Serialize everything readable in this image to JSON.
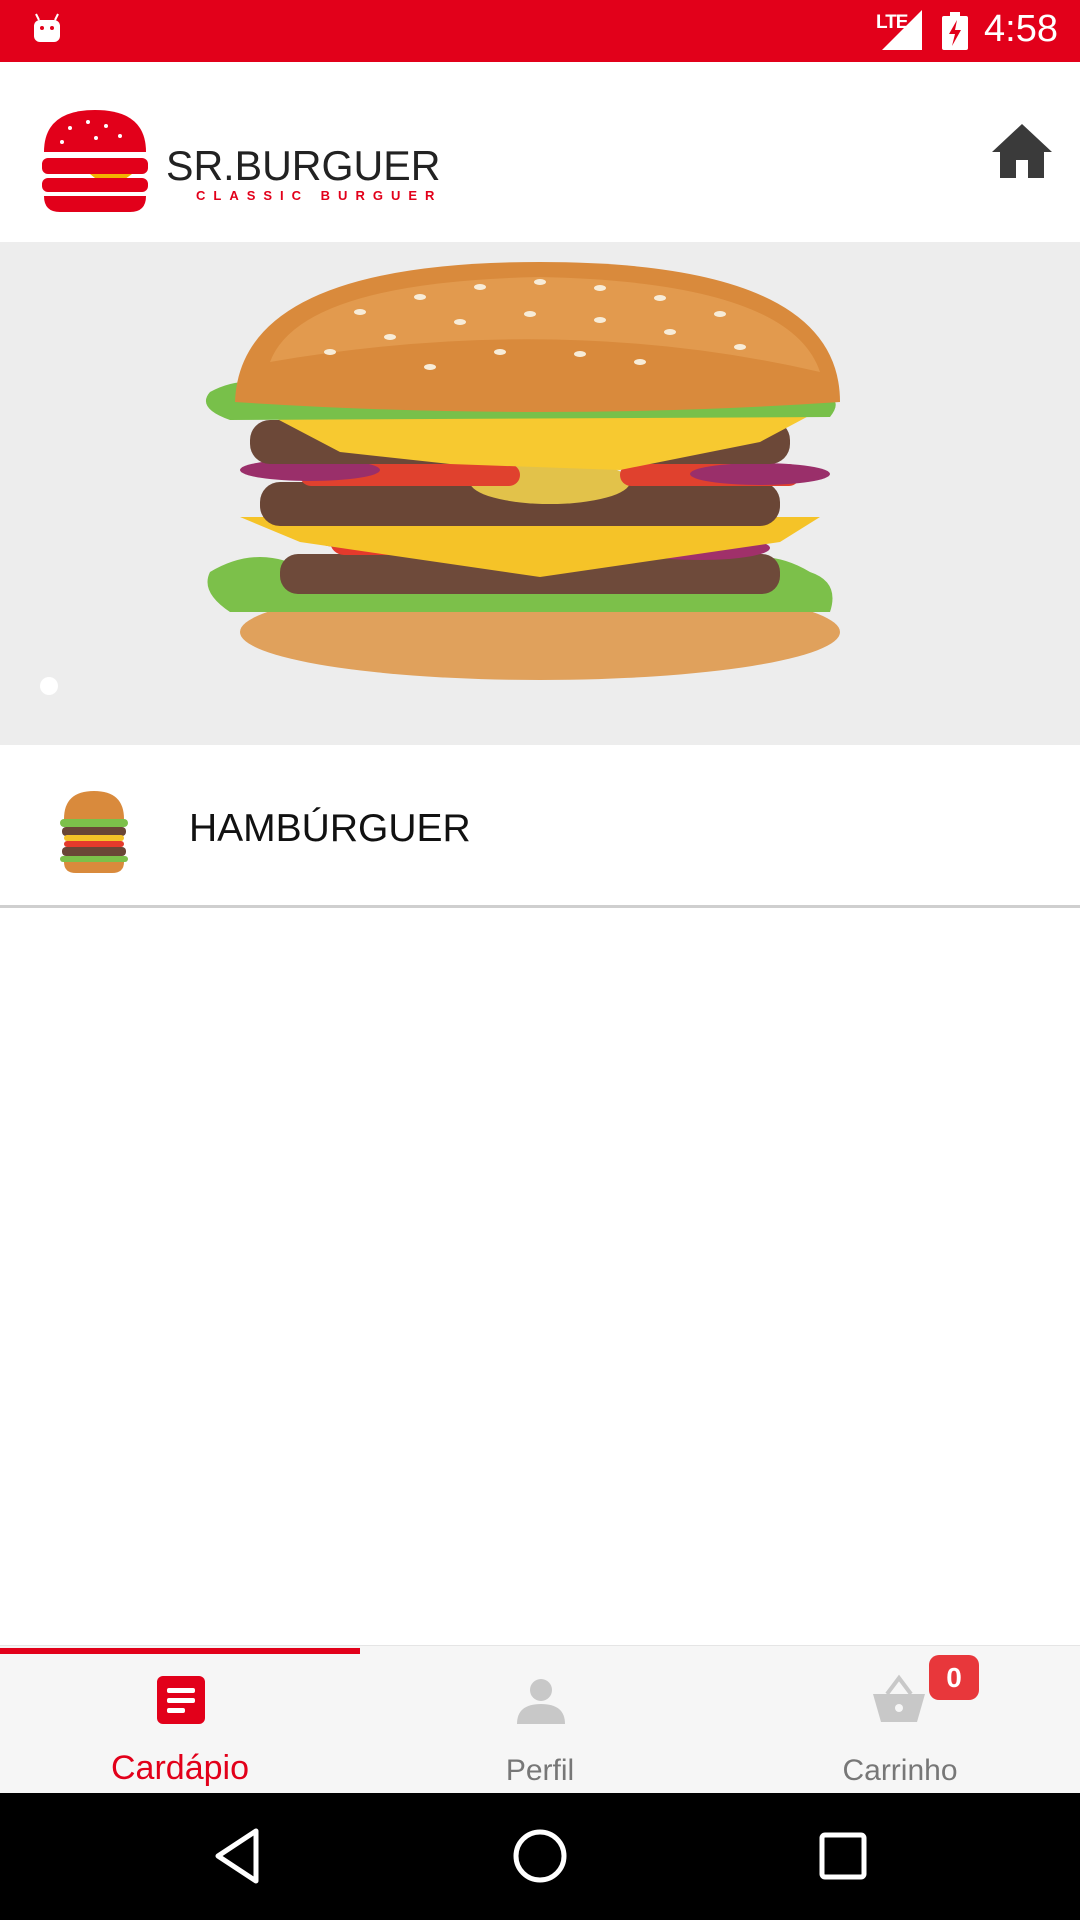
{
  "status_bar": {
    "network": "LTE",
    "time": "4:58",
    "icons": [
      "android-icon",
      "signal-icon",
      "battery-charging-icon"
    ]
  },
  "header": {
    "brand_name": "SR.BURGUER",
    "tagline": "CLASSIC BURGUER",
    "home_icon": "home-icon"
  },
  "banner": {
    "image": "burger-photo",
    "active_slide": 1,
    "slide_count": 1
  },
  "categories": [
    {
      "label": "HAMBÚRGUER",
      "thumbnail": "burger-thumbnail"
    }
  ],
  "bottom_nav": {
    "tabs": [
      {
        "label": "Cardápio",
        "icon": "menu-list-icon",
        "active": true
      },
      {
        "label": "Perfil",
        "icon": "person-icon",
        "active": false
      },
      {
        "label": "Carrinho",
        "icon": "basket-icon",
        "active": false
      }
    ],
    "cart_count": "0"
  },
  "colors": {
    "brand": "#e2001a",
    "badge": "#e8373b",
    "inactive": "#777777"
  },
  "system_nav": [
    "back-icon",
    "home-circle-icon",
    "recents-icon"
  ]
}
